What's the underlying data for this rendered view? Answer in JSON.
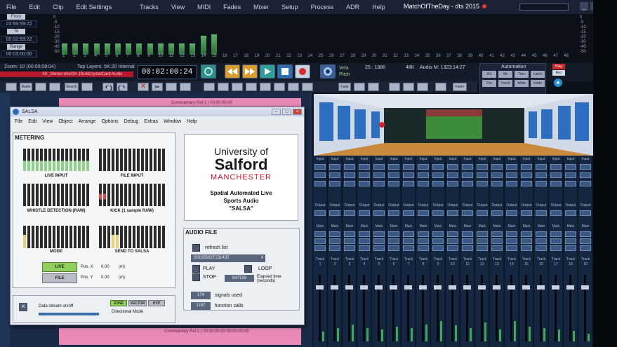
{
  "app": {
    "title": "MatchOfTheDay - dts 2015"
  },
  "menubar": {
    "items": [
      "File",
      "Edit",
      "Clip",
      "Edit Settings",
      "Tracks",
      "View",
      "MIDI",
      "Fades",
      "Mixer",
      "Setup",
      "Process",
      "ADR",
      "Help"
    ]
  },
  "time_panel": {
    "from_label": "From",
    "from_value": "23:59:59:22",
    "to_label": "To",
    "to_value": "00:02:59:22",
    "range_label": "Range",
    "range_value": "00:03:00:00"
  },
  "meter_scale": [
    "0",
    "-5",
    "-10",
    "-15",
    "-20",
    "-30",
    "-40",
    "-50"
  ],
  "meter_numbers": [
    "1",
    "2",
    "3",
    "4",
    "5",
    "6",
    "7",
    "8",
    "9",
    "10",
    "11",
    "12",
    "13",
    "14",
    "15",
    "16",
    "17",
    "18",
    "19",
    "20",
    "21",
    "22",
    "23",
    "24",
    "25",
    "26",
    "27",
    "28",
    "29",
    "30",
    "31",
    "32",
    "33",
    "34",
    "35",
    "36",
    "37",
    "38",
    "39",
    "40",
    "41",
    "42",
    "43",
    "44",
    "45",
    "46",
    "47",
    "48"
  ],
  "meter_levels": [
    0.35,
    0.35,
    0.35,
    0.35,
    0.35,
    0.35,
    0.35,
    0.35,
    0.35,
    0.35,
    0.35,
    0.35,
    0.35,
    0.6,
    0.65,
    0,
    0,
    0,
    0,
    0,
    0,
    0,
    0,
    0,
    0,
    0,
    0,
    0,
    0,
    0,
    0,
    0,
    0,
    0,
    0,
    0,
    0,
    0,
    0,
    0,
    0,
    0,
    0,
    0,
    0,
    0,
    0,
    0
  ],
  "transport": {
    "zoom": "Zoom: 10 (00:00:08:04)",
    "layers": "Top Layers: 5K:20 Internal",
    "clip_bar_text": "AK_Stereo.mix/On JSU6CrystalCard Audio",
    "timecode": "00:02:00:24",
    "rate_lines": [
      "Vela",
      "Pitch"
    ],
    "frames": "25 : 1880",
    "sample_rate": "48K",
    "audio_m": "Audio M: 1323:14:27",
    "automation_title": "Automation",
    "automation_buttons": [
      "Rd",
      "Wr",
      "Trim",
      "Latch",
      "Ovr",
      "Touch",
      "Write",
      "Undo"
    ],
    "play_label": "Play",
    "rec_label": "Rec"
  },
  "toolbar": {
    "labels": [
      "Audio Rtn",
      "Search",
      "Fade",
      "Fader"
    ]
  },
  "timeline": {
    "clip_top": "Commentary Ref 1 | 00:00:00:00",
    "clip_bottom": "Commentary Ref 1 | 00:00:00:00 00:00:00:00"
  },
  "mixer": {
    "strip_top_label": "Input",
    "output_label": "Output",
    "main_label": "Main",
    "track_label": "Track",
    "strip_numbers": [
      "1",
      "2",
      "3",
      "4",
      "5",
      "6",
      "7",
      "8",
      "9",
      "10",
      "11",
      "12",
      "13",
      "14",
      "15",
      "16",
      "17",
      "18",
      "19"
    ],
    "levels": [
      0.15,
      0.2,
      0.25,
      0.2,
      0.18,
      0.22,
      0.2,
      0.25,
      0.3,
      0.24,
      0.2,
      0.28,
      0.18,
      0.3,
      0.22,
      0.2,
      0.18,
      0.16,
      0.12
    ]
  },
  "salsa": {
    "window_title": "SALSA",
    "menu": [
      "File",
      "Edit",
      "View",
      "Object",
      "Arrange",
      "Options",
      "Debug",
      "Extras",
      "Window",
      "Help"
    ],
    "metering_title": "METERING",
    "live_input": "LIVE INPUT",
    "file_input": "FILE INPUT",
    "whistle": "WHISTLE DETECTION (RAW)",
    "kick": "KICK (1 sample RAW)",
    "mode": "MODE",
    "send": "SEND TO SALSA",
    "live_btn": "LIVE",
    "file_btn": "FILE",
    "pos_x_label": "Pos. X",
    "pos_x_value": "0.00",
    "pos_x_unit": "(m)",
    "pos_y_label": "Pos. Y",
    "pos_y_value": "0.00",
    "pos_y_unit": "(m)",
    "logo_line1": "University of",
    "logo_line2": "Salford",
    "logo_line3": "MANCHESTER",
    "tagline1": "Spatial Automated Live",
    "tagline2": "Sports Audio",
    "tagline3": "\"SALSA\"",
    "audio_file_title": "AUDIO FILE",
    "refresh": "refresh list",
    "file_select": "20150502T131450",
    "play": "PLAY",
    "loop": "LOOP",
    "stop": "STOP",
    "elapsed_value": "947159",
    "elapsed_label": "Elapsed time (seconds)",
    "signals_value": "174",
    "signals_label": "signals used",
    "calls_value": "1187",
    "calls_label": "function calls",
    "datastream_label": "Data stream on/off",
    "zone_btn": "ZONE",
    "vector_btn": "VECTOR",
    "hyp_btn": "HYP",
    "directional": "Directional Mode"
  },
  "colors": {
    "accent_green": "#8fcf5b",
    "record_red": "#d82a2a",
    "clip_pink": "#e98ab6"
  }
}
